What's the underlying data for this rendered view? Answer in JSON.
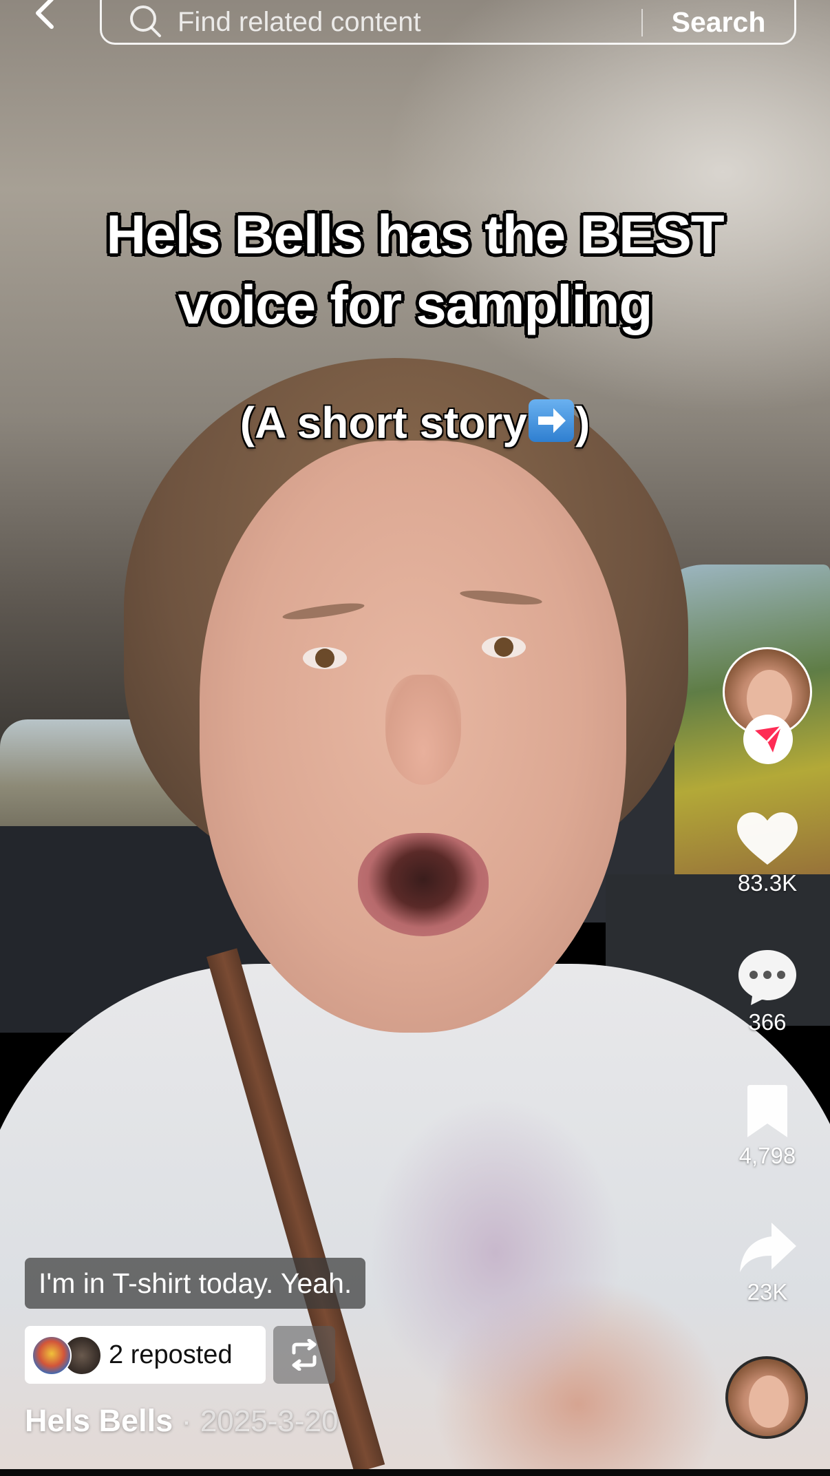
{
  "search": {
    "placeholder": "Find related content",
    "button_label": "Search"
  },
  "video": {
    "title_line1": "Hels Bells has the BEST",
    "title_line2": "voice for sampling",
    "subtitle_before": "(A short story",
    "subtitle_after": ")",
    "caption": "I'm in T-shirt today. Yeah."
  },
  "actions": {
    "likes": "83.3K",
    "comments": "366",
    "saves": "4,798",
    "shares": "23K"
  },
  "repost": {
    "label": "2 reposted"
  },
  "author": {
    "name": "Hels Bells",
    "separator": "·",
    "date": "2025-3-20"
  },
  "colors": {
    "accent": "#fe2c55",
    "text": "#ffffff"
  },
  "icons": {
    "back": "chevron-left-icon",
    "search": "search-icon",
    "like": "heart-icon",
    "comment": "comment-icon",
    "save": "bookmark-icon",
    "share": "share-icon",
    "follow": "send-icon",
    "repost": "repost-icon",
    "subtitle_emoji": "right-arrow-emoji"
  }
}
